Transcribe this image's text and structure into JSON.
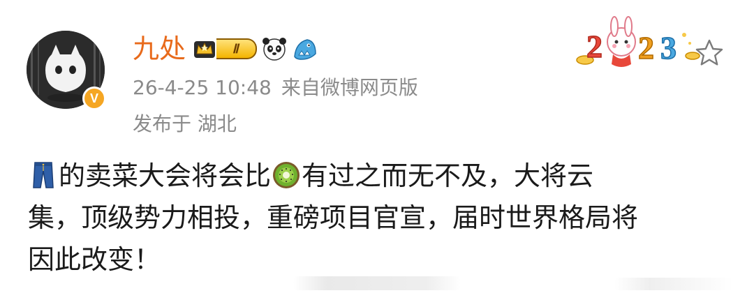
{
  "post": {
    "author": {
      "name": "九处",
      "verified_mark": "V",
      "level_badge": "Ⅱ"
    },
    "badges": [
      "crown-level-badge",
      "panda-icon",
      "shark-icon"
    ],
    "time": "26-4-25 10:48",
    "source": "来自微博网页版",
    "location": "发布于 湖北",
    "header_decoration": "2023-rabbit-decoration",
    "content": {
      "line1_after_jeans": "的卖菜大会将会比",
      "line1_after_kiwi": "有过之而无不及，大将云",
      "line2": "集，顶级势力相投，重磅项目官宣，届时世界格局将",
      "line3": "因此改变！",
      "emojis": [
        "jeans-emoji",
        "kiwi-emoji"
      ]
    }
  },
  "colors": {
    "username": "#e86a1b",
    "meta": "#8a8a8a",
    "verified": "#f5a623"
  }
}
